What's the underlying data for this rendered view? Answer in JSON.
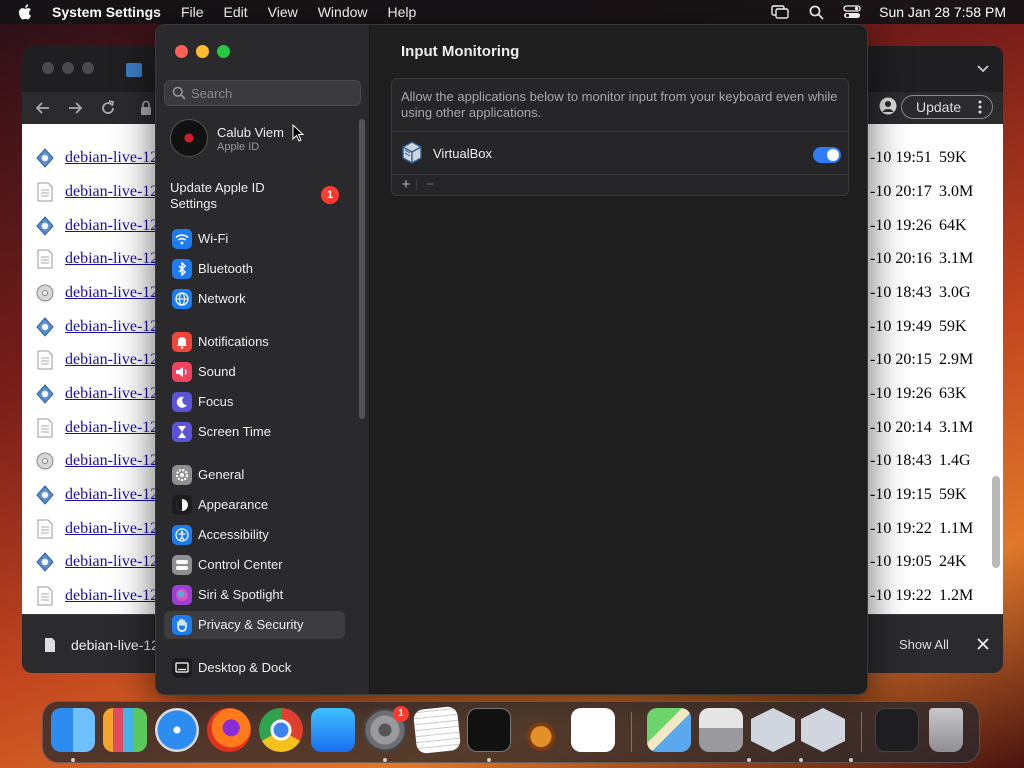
{
  "menubar": {
    "app_name": "System Settings",
    "items": [
      "File",
      "Edit",
      "View",
      "Window",
      "Help"
    ],
    "datetime": "Sun Jan 28  7:58 PM"
  },
  "browser": {
    "update_label": "Update",
    "files": [
      {
        "name": "debian-live-12",
        "date": "-10 19:51",
        "size": "59K",
        "icon": "signature-icon"
      },
      {
        "name": "debian-live-12",
        "date": "-10 20:17",
        "size": "3.0M",
        "icon": "text-file-icon"
      },
      {
        "name": "debian-live-12",
        "date": "-10 19:26",
        "size": "64K",
        "icon": "signature-icon"
      },
      {
        "name": "debian-live-12",
        "date": "-10 20:16",
        "size": "3.1M",
        "icon": "text-file-icon"
      },
      {
        "name": "debian-live-12",
        "date": "-10 18:43",
        "size": "3.0G",
        "icon": "disc-icon"
      },
      {
        "name": "debian-live-12",
        "date": "-10 19:49",
        "size": "59K",
        "icon": "signature-icon"
      },
      {
        "name": "debian-live-12",
        "date": "-10 20:15",
        "size": "2.9M",
        "icon": "text-file-icon"
      },
      {
        "name": "debian-live-12",
        "date": "-10 19:26",
        "size": "63K",
        "icon": "signature-icon"
      },
      {
        "name": "debian-live-12",
        "date": "-10 20:14",
        "size": "3.1M",
        "icon": "text-file-icon"
      },
      {
        "name": "debian-live-12",
        "date": "-10 18:43",
        "size": "1.4G",
        "icon": "disc-icon"
      },
      {
        "name": "debian-live-12",
        "date": "-10 19:15",
        "size": "59K",
        "icon": "signature-icon"
      },
      {
        "name": "debian-live-12",
        "date": "-10 19:22",
        "size": "1.1M",
        "icon": "text-file-icon"
      },
      {
        "name": "debian-live-12",
        "date": "-10 19:05",
        "size": "24K",
        "icon": "signature-icon"
      },
      {
        "name": "debian-live-12",
        "date": "-10 19:22",
        "size": "1.2M",
        "icon": "text-file-icon"
      }
    ],
    "download_name": "debian-live-12",
    "show_all_label": "Show All"
  },
  "settings": {
    "search_placeholder": "Search",
    "account_name": "Calub Viem",
    "account_sub": "Apple ID",
    "update_apple_id_label": "Update Apple ID Settings",
    "update_badge": "1",
    "nav_items": [
      {
        "label": "Wi-Fi",
        "icon": "wifi-icon",
        "color": "#1e7cf2"
      },
      {
        "label": "Bluetooth",
        "icon": "bluetooth-icon",
        "color": "#1e7cf2"
      },
      {
        "label": "Network",
        "icon": "globe-icon",
        "color": "#1e7cf2"
      },
      {
        "label": "Notifications",
        "icon": "bell-icon",
        "color": "#f0453a"
      },
      {
        "label": "Sound",
        "icon": "speaker-icon",
        "color": "#f0445e"
      },
      {
        "label": "Focus",
        "icon": "moon-icon",
        "color": "#5b54d6"
      },
      {
        "label": "Screen Time",
        "icon": "hourglass-icon",
        "color": "#5b54d6"
      },
      {
        "label": "General",
        "icon": "gear-icon",
        "color": "#8e8e93"
      },
      {
        "label": "Appearance",
        "icon": "appearance-icon",
        "color": "#1c1c1e"
      },
      {
        "label": "Accessibility",
        "icon": "accessibility-icon",
        "color": "#1e7cf2"
      },
      {
        "label": "Control Center",
        "icon": "control-center-icon",
        "color": "#8e8e93"
      },
      {
        "label": "Siri & Spotlight",
        "icon": "siri-icon",
        "color": "#9b3fd6"
      },
      {
        "label": "Privacy & Security",
        "icon": "hand-icon",
        "color": "#1e7cf2"
      },
      {
        "label": "Desktop & Dock",
        "icon": "desktop-icon",
        "color": "#1c1c1e"
      }
    ],
    "detail_title": "Input Monitoring",
    "detail_description": "Allow the applications below to monitor input from your keyboard even while using other applications.",
    "apps": [
      {
        "name": "VirtualBox",
        "enabled": true
      }
    ],
    "accent_color": "#2f7cf6"
  },
  "dock": {
    "settings_badge": "1",
    "items": [
      "finder-icon",
      "launchpad-icon",
      "safari-icon",
      "firefox-icon",
      "chrome-icon",
      "app-store-icon",
      "system-settings-icon",
      "textedit-icon",
      "terminal-icon",
      "garageband-icon",
      "vscode-icon",
      "maps-icon",
      "disk-utility-icon",
      "virtualbox-icon",
      "virtualbox-vm-icon",
      "downloads-stack-icon",
      "trash-icon"
    ]
  }
}
